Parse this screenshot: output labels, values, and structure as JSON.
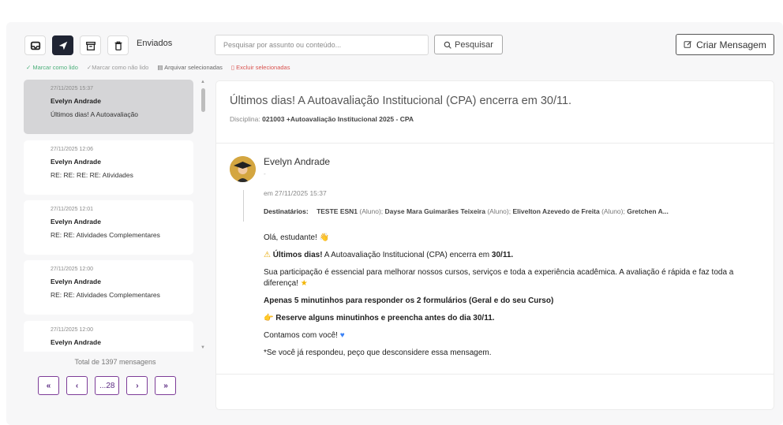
{
  "toolbar": {
    "icons": [
      "inbox-icon",
      "send-icon",
      "archive-icon",
      "trash-icon"
    ],
    "active_tab_label": "Enviados",
    "search_placeholder": "Pesquisar por assunto ou conteúdo...",
    "search_button_label": "Pesquisar",
    "create_button_label": "Criar Mensagem"
  },
  "actions": {
    "mark_read": "Marcar como lido",
    "mark_unread": "Marcar como não lido",
    "archive": "Arquivar selecionadas",
    "delete": "Excluir selecionadas"
  },
  "messages": [
    {
      "date": "27/11/2025 15:37",
      "sender": "Evelyn Andrade",
      "subject": "Últimos dias! A Autoavaliação",
      "selected": true
    },
    {
      "date": "27/11/2025 12:06",
      "sender": "Evelyn Andrade",
      "subject": "RE: RE: RE: RE: Atividades"
    },
    {
      "date": "27/11/2025 12:01",
      "sender": "Evelyn Andrade",
      "subject": "RE: RE: Atividades Complementares"
    },
    {
      "date": "27/11/2025 12:00",
      "sender": "Evelyn Andrade",
      "subject": "RE: RE: Atividades Complementares"
    },
    {
      "date": "27/11/2025 12:00",
      "sender": "Evelyn Andrade",
      "subject": ""
    }
  ],
  "list_footer": {
    "total": "Total de 1397 mensagens",
    "pager": {
      "first": "«",
      "prev": "‹",
      "page": "...28",
      "next": "›",
      "last": "»"
    }
  },
  "detail": {
    "subject": "Últimos dias! A Autoavaliação Institucional (CPA) encerra em 30/11.",
    "discipline_label": "Disciplina:",
    "discipline_value": "021003 +Autoavaliação Institucional 2025 - CPA",
    "sender": "Evelyn Andrade",
    "dash": "-",
    "when": "em 27/11/2025 15:37",
    "recipients_label": "Destinatários:",
    "recipients": [
      {
        "name": "TESTE ESN1",
        "role": "(Aluno);"
      },
      {
        "name": "Dayse Mara Guimarães Teixeira",
        "role": "(Aluno);"
      },
      {
        "name": "Elivelton Azevedo de Freita",
        "role": "(Aluno);"
      },
      {
        "name": "Gretchen A...",
        "role": ""
      }
    ],
    "body": {
      "greeting": "Olá, estudante!",
      "alert_bold": "Últimos dias!",
      "alert_text": " A Autoavaliação Institucional (CPA) encerra em ",
      "alert_date": "30/11.",
      "p2": "Sua participação é essencial para melhorar nossos cursos, serviços e toda a experiência acadêmica. A avaliação é rápida e faz toda a diferença!",
      "p3": "Apenas 5 minutinhos para responder os 2 formulários (Geral e do seu Curso)",
      "p4": "Reserve alguns minutinhos e preencha antes do dia 30/11.",
      "p5": "Contamos com você!",
      "p6": "*Se você já respondeu, peço que desconsidere essa mensagem."
    }
  },
  "colors": {
    "accent_purple": "#7d3c98",
    "active_icon_bg": "#1f2433",
    "read_green": "#4caf7a",
    "delete_red": "#d9534f"
  }
}
